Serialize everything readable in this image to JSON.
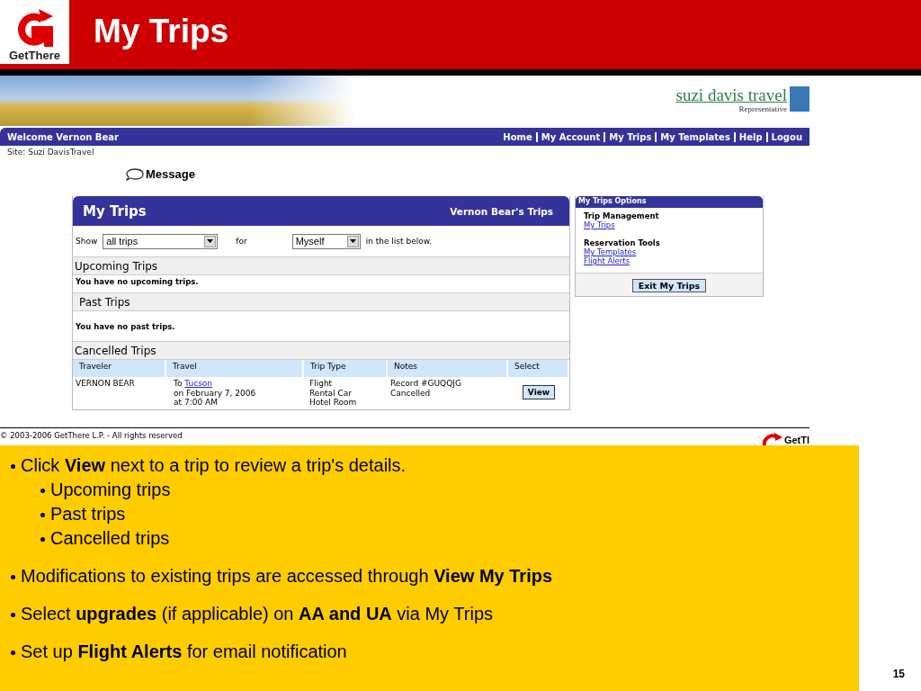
{
  "slide": {
    "logo_text": "GetThere",
    "title": "My Trips",
    "page_number": "15"
  },
  "site": {
    "brand": "suzi davis travel",
    "brand_sub": "Representative",
    "welcome": "Welcome Vernon Bear",
    "nav": [
      {
        "label": "Home"
      },
      {
        "label": "My Account"
      },
      {
        "label": "My Trips"
      },
      {
        "label": "My Templates"
      },
      {
        "label": "Help"
      },
      {
        "label": "Logou"
      }
    ],
    "site_line": "Site: Suzi DavisTravel",
    "message": "Message",
    "panel": {
      "title": "My Trips",
      "owner": "Vernon Bear's Trips",
      "show_label": "Show",
      "show_value": "all trips",
      "for_label": "for",
      "for_value": "Myself",
      "tail": "in the list below.",
      "sections": [
        {
          "title": "Upcoming Trips",
          "empty": "You have no upcoming trips."
        },
        {
          "title": "Past Trips",
          "empty": "You have no past trips."
        },
        {
          "title": "Cancelled Trips"
        }
      ],
      "columns": [
        "Traveler",
        "Travel",
        "Trip Type",
        "Notes",
        "Select"
      ],
      "rows": [
        {
          "traveler": "VERNON BEAR",
          "travel_prefix": "To",
          "travel_link": "Tucson",
          "travel_lines": [
            "on February 7, 2006",
            "at 7:00 AM"
          ],
          "types": [
            "Flight",
            "Rental Car",
            "Hotel Room"
          ],
          "notes": [
            "Record #GUQQJG",
            "Cancelled"
          ],
          "action": "View"
        }
      ]
    },
    "options": {
      "title": "My Trips Options",
      "groups": [
        {
          "heading": "Trip Management",
          "links": [
            "My Trips"
          ]
        },
        {
          "heading": "Reservation Tools",
          "links": [
            "My Templates",
            "Flight Alerts"
          ]
        }
      ],
      "button": "Exit My Trips"
    },
    "copyright": "© 2003-2006 GetThere L.P. - All rights reserved",
    "footer_logo": "GetTl"
  },
  "bullets": [
    {
      "text": "Click **View** next to a trip to review a trip's details.",
      "children": [
        {
          "text": "Upcoming trips"
        },
        {
          "text": "Past trips"
        },
        {
          "text": "Cancelled trips"
        }
      ]
    },
    {
      "text": "Modifications to existing trips are accessed through **View My Trips**"
    },
    {
      "text": "Select **upgrades** (if applicable) on **AA and UA** via My Trips"
    },
    {
      "text": "Set up **Flight Alerts** for email notification"
    }
  ]
}
